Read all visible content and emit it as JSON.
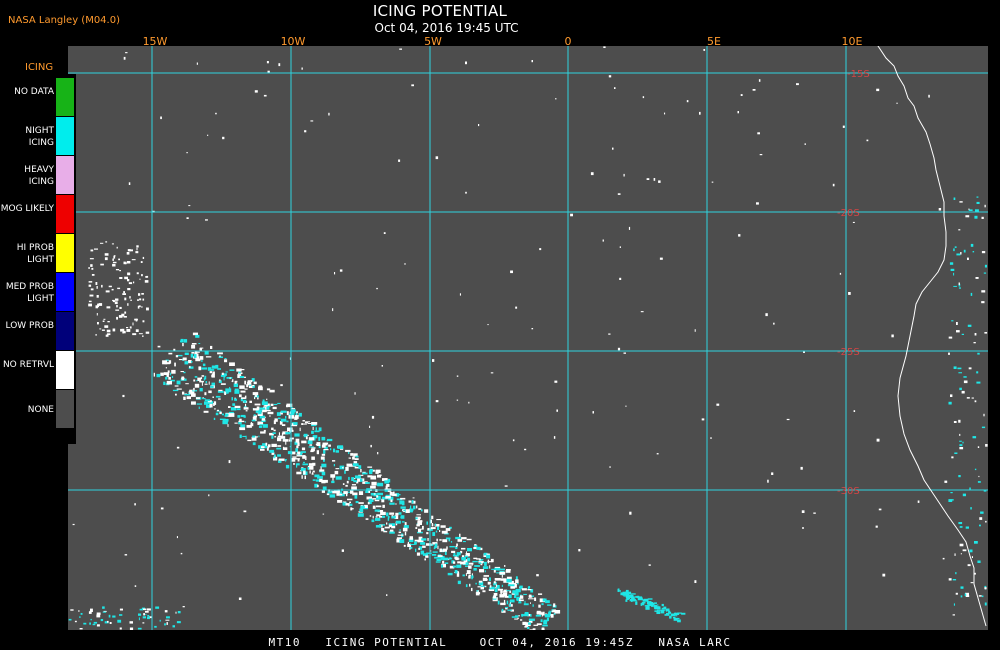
{
  "header": {
    "source": "NASA Langley (M04.0)",
    "title": "ICING POTENTIAL",
    "subtitle": "Oct 04, 2016 19:45 UTC"
  },
  "map": {
    "longitude_labels": [
      "15W",
      "10W",
      "5W",
      "0",
      "5E",
      "10E"
    ],
    "latitude_labels": [
      "-15S",
      "-20S",
      "-25S",
      "-30S"
    ],
    "background_color": "#4d4d4d",
    "grid_color": "#2fd3df",
    "coastline_color": "#ffffff"
  },
  "legend": {
    "title": "ICING",
    "items": [
      {
        "label": "NO DATA",
        "color": "#17b317"
      },
      {
        "label": "NIGHT ICING",
        "color": "#00eded"
      },
      {
        "label": "HEAVY ICING",
        "color": "#e8aee8"
      },
      {
        "label": "MOG LIKELY",
        "color": "#ee0000"
      },
      {
        "label": "HI PROB LIGHT",
        "color": "#ffff00"
      },
      {
        "label": "MED PROB LIGHT",
        "color": "#0000ff"
      },
      {
        "label": "LOW PROB",
        "color": "#00007a"
      },
      {
        "label": "NO RETRVL",
        "color": "#ffffff"
      },
      {
        "label": "NONE",
        "color": "#4d4d4d"
      }
    ]
  },
  "footer": {
    "text": "MT10   ICING POTENTIAL    OCT 04, 2016 19:45Z   NASA LARC"
  }
}
